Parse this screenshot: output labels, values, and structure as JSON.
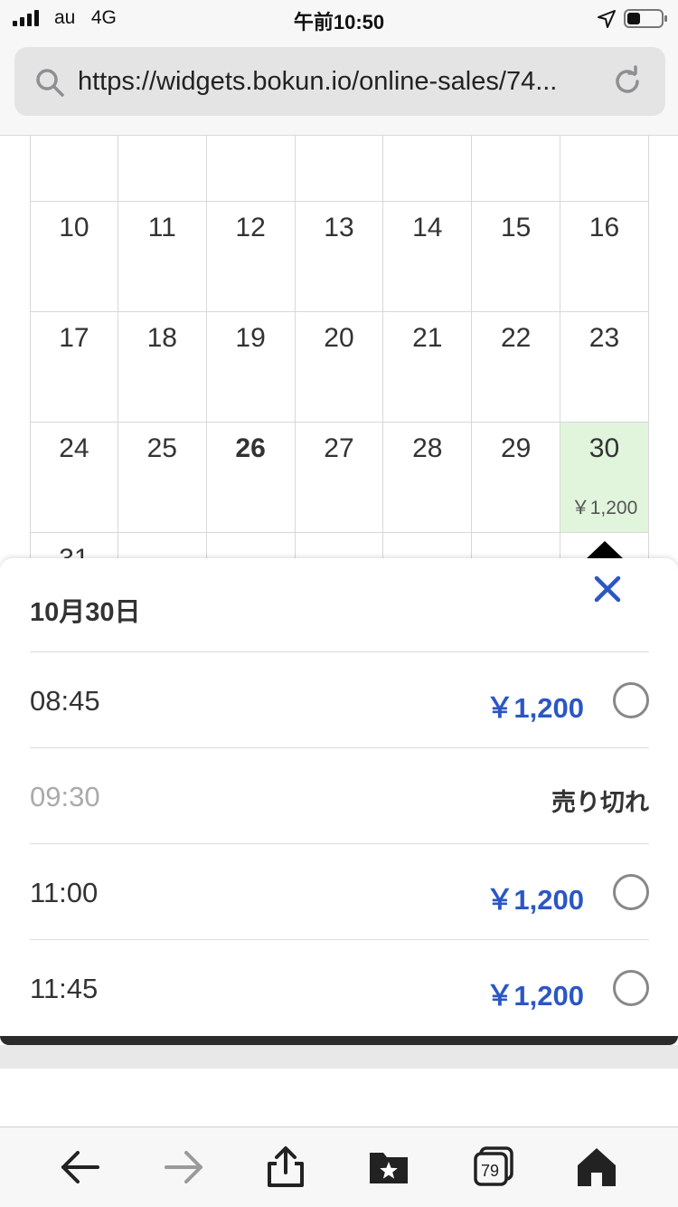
{
  "status": {
    "carrier": "au",
    "network": "4G",
    "time": "午前10:50"
  },
  "browser": {
    "url": "https://widgets.bokun.io/online-sales/74...",
    "tab_count": "79"
  },
  "calendar": {
    "rows": [
      {
        "days": [
          "",
          "",
          "",
          "",
          "",
          "",
          ""
        ]
      },
      {
        "days": [
          "10",
          "11",
          "12",
          "13",
          "14",
          "15",
          "16"
        ]
      },
      {
        "days": [
          "17",
          "18",
          "19",
          "20",
          "21",
          "22",
          "23"
        ]
      },
      {
        "days": [
          "24",
          "25",
          "26",
          "27",
          "28",
          "29",
          "30"
        ]
      },
      {
        "days": [
          "31",
          "",
          "",
          "",
          "",
          "",
          ""
        ]
      }
    ],
    "today": "26",
    "available_day": "30",
    "available_price": "￥1,200",
    "highlight_color": "#e1f5dd"
  },
  "panel": {
    "date_title": "10月30日",
    "close_icon": "close-icon",
    "accent_color": "#2b57c4",
    "slots": [
      {
        "time": "08:45",
        "price": "￥1,200",
        "sold_out": false
      },
      {
        "time": "09:30",
        "price": "",
        "sold_out": true,
        "status": "売り切れ"
      },
      {
        "time": "11:00",
        "price": "￥1,200",
        "sold_out": false
      },
      {
        "time": "11:45",
        "price": "￥1,200",
        "sold_out": false
      }
    ]
  },
  "toolbar": {
    "icons": [
      "back-icon",
      "forward-icon",
      "share-icon",
      "bookmarks-icon",
      "tabs-icon",
      "home-icon"
    ]
  }
}
